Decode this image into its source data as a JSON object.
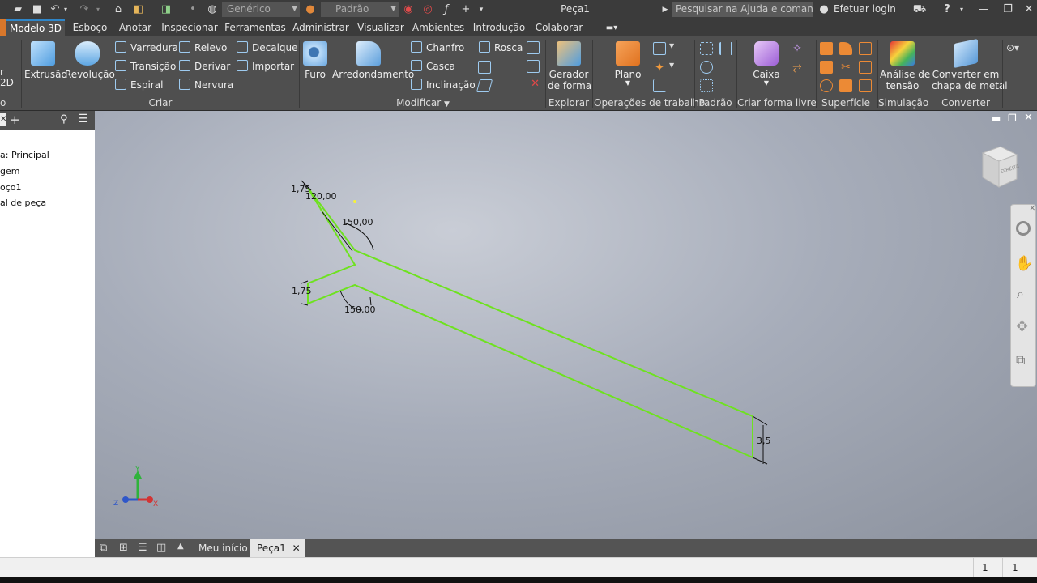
{
  "titlebar": {
    "material_value": "Genérico",
    "appearance_value": "Padrão",
    "document_title": "Peça1",
    "help_search_placeholder": "Pesquisar na Ajuda e comandos...",
    "login_label": "Efetuar login"
  },
  "tabs": [
    "Modelo 3D",
    "Esboço",
    "Anotar",
    "Inspecionar",
    "Ferramentas",
    "Administrar",
    "Visualizar",
    "Ambientes",
    "Introdução",
    "Colaborar"
  ],
  "ribbon": {
    "left_partial": {
      "line1": "r",
      "line2": "2D",
      "line3": "o"
    },
    "criar": {
      "label": "Criar",
      "extrusao": "Extrusão",
      "revolucao": "Revolução",
      "varredura": "Varredura",
      "transicao": "Transição",
      "espiral": "Espiral",
      "relevo": "Relevo",
      "derivar": "Derivar",
      "nervura": "Nervura",
      "decalque": "Decalque",
      "importar": "Importar"
    },
    "modificar": {
      "label": "Modificar",
      "furo": "Furo",
      "arredondamento": "Arredondamento",
      "chanfro": "Chanfro",
      "casca": "Casca",
      "inclinacao": "Inclinação",
      "rosca": "Rosca"
    },
    "explorar": {
      "label": "Explorar",
      "gerador_l1": "Gerador",
      "gerador_l2": "de forma"
    },
    "operacoes": {
      "label": "Operações de trabalho",
      "plano": "Plano"
    },
    "padrao": {
      "label": "Padrão"
    },
    "criar_forma_livre": {
      "label": "Criar forma livre",
      "caixa": "Caixa"
    },
    "superficie": {
      "label": "Superfície"
    },
    "simulacao": {
      "label": "Simulação",
      "analise_l1": "Análise de",
      "analise_l2": "tensão"
    },
    "converter": {
      "label": "Converter",
      "conv_l1": "Converter em",
      "conv_l2": "chapa de metal"
    }
  },
  "browser": {
    "items": [
      "a: Principal",
      "gem",
      "oço1",
      "al de peça"
    ]
  },
  "viewport": {
    "viewcube_label": "DIREITA",
    "dimensions": {
      "d1": "1,75",
      "d2": "120,00",
      "d3": "150,00",
      "d4": "1,75",
      "d5": "150,00",
      "d6": "3,5"
    },
    "axes": {
      "x": "X",
      "y": "Y",
      "z": "Z"
    }
  },
  "doc_tabs": {
    "home": "Meu início",
    "part": "Peça1"
  },
  "status": {
    "val1": "1",
    "val2": "1"
  },
  "colors": {
    "sketch_line": "#6ee21f",
    "accent": "#2f86c9",
    "app_orange": "#d8772b"
  }
}
